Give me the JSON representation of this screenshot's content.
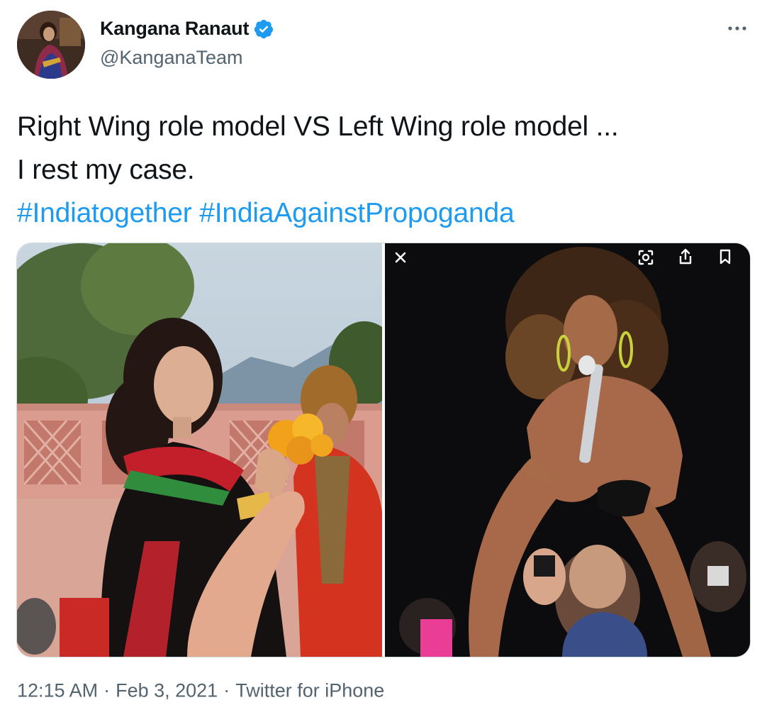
{
  "author": {
    "display_name": "Kangana Ranaut",
    "handle": "@KanganaTeam",
    "verified": true,
    "avatar_icon": "profile-photo"
  },
  "header": {
    "more_icon": "more-horizontal-icon"
  },
  "tweet": {
    "line1": "Right Wing role model VS Left Wing role model ...",
    "line2": "I rest my case.",
    "hashtags": [
      "#Indiatogether",
      "#IndiaAgainstPropoganda"
    ]
  },
  "media": {
    "photos": [
      {
        "icon": "photo-woman-praying-with-flowers"
      },
      {
        "icon": "photo-singer-performing-on-stage"
      }
    ],
    "overlay_icons": [
      "close-icon",
      "lens-search-icon",
      "share-icon",
      "bookmark-icon"
    ]
  },
  "footer": {
    "time": "12:15 AM",
    "separator": "·",
    "date": "Feb 3, 2021",
    "source": "Twitter for iPhone"
  },
  "colors": {
    "text": "#0f1419",
    "secondary": "#536471",
    "link": "#1d9bf0",
    "verified": "#1d9bf0"
  }
}
